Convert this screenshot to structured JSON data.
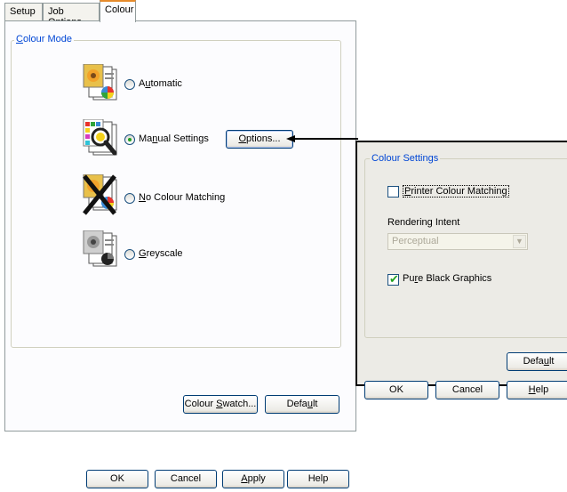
{
  "tabs": [
    {
      "label": "Setup"
    },
    {
      "label": "Job Options"
    },
    {
      "label": "Colour"
    }
  ],
  "colour_mode": {
    "group_label": "Colour Mode",
    "options": [
      {
        "label": "Automatic",
        "selected": false,
        "icon": "auto-colour-icon"
      },
      {
        "label": "Manual Settings",
        "selected": true,
        "icon": "manual-colour-icon"
      },
      {
        "label": "No Colour Matching",
        "selected": false,
        "icon": "no-colour-matching-icon"
      },
      {
        "label": "Greyscale",
        "selected": false,
        "icon": "greyscale-icon"
      }
    ],
    "options_button": "Options..."
  },
  "panel_buttons": {
    "colour_swatch": "Colour Swatch...",
    "default": "Default"
  },
  "dialog_buttons": {
    "ok": "OK",
    "cancel": "Cancel",
    "apply": "Apply",
    "help": "Help"
  },
  "colour_settings": {
    "group_label": "Colour Settings",
    "printer_colour_matching": {
      "label": "Printer Colour Matching",
      "checked": false
    },
    "rendering_intent": {
      "label": "Rendering Intent",
      "value": "Perceptual",
      "disabled": true
    },
    "pure_black_graphics": {
      "label": "Pure Black Graphics",
      "checked": true
    },
    "buttons": {
      "default": "Default",
      "ok": "OK",
      "cancel": "Cancel",
      "help": "Help"
    }
  }
}
